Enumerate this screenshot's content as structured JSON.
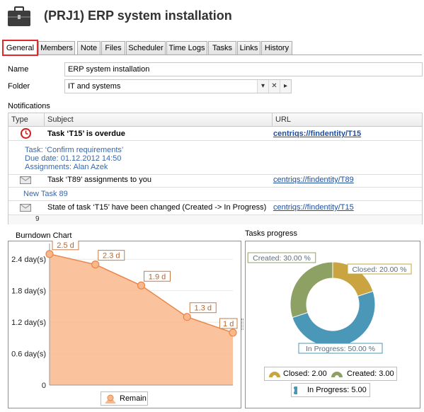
{
  "window": {
    "title": "(PRJ1) ERP system installation",
    "icon": "briefcase-icon"
  },
  "tabs": [
    {
      "label": "General",
      "active": true
    },
    {
      "label": "Members"
    },
    {
      "label": "Note"
    },
    {
      "label": "Files"
    },
    {
      "label": "Scheduler"
    },
    {
      "label": "Time Logs"
    },
    {
      "label": "Tasks"
    },
    {
      "label": "Links"
    },
    {
      "label": "History"
    }
  ],
  "form": {
    "name_label": "Name",
    "name_value": "ERP system installation",
    "folder_label": "Folder",
    "folder_value": "IT and systems"
  },
  "notifications": {
    "title": "Notifications",
    "columns": [
      "Type",
      "Subject",
      "URL"
    ],
    "rows": [
      {
        "icon": "overdue-clock-icon",
        "subject": "Task ‘T15’ is overdue",
        "url": "centriqs://findentity/T15",
        "details": [
          "Task: ‘Confirm requirements’",
          "Due date: 01.12.2012 14:50",
          "Assignments: Alan Azek"
        ]
      },
      {
        "icon": "envelope-icon",
        "subject": "Task ‘T89’ assignments to you",
        "url": "centriqs://findentity/T89",
        "details": [
          "New Task 89"
        ]
      },
      {
        "icon": "envelope-icon",
        "subject": "State of task ‘T15’ have been changed (Created -> In Progress)",
        "url": "centriqs://findentity/T15",
        "details": []
      }
    ],
    "footer_count": "9"
  },
  "burndown": {
    "title": "Burndown Chart",
    "legend": "Remain",
    "fill_color": "#f9b88c",
    "line_color": "#e8864a"
  },
  "progress": {
    "title": "Tasks progress",
    "legend": [
      {
        "label": "Closed: 2.00",
        "color": "#c9a441"
      },
      {
        "label": "Created: 3.00",
        "color": "#8ea165"
      },
      {
        "label": "In Progress: 5.00",
        "color": "#4a97b8"
      }
    ]
  },
  "chart_data": [
    {
      "type": "area",
      "title": "Burndown Chart",
      "series": [
        {
          "name": "Remain",
          "x": [
            1,
            2,
            3,
            4,
            5
          ],
          "values": [
            2.5,
            2.3,
            1.9,
            1.3,
            1.0
          ],
          "labels": [
            "2.5 d",
            "2.3 d",
            "1.9 d",
            "1.3 d",
            "1 d"
          ]
        }
      ],
      "yticks": [
        "0",
        "0.6 day(s)",
        "1.2 day(s)",
        "1.8 day(s)",
        "2.4 day(s)"
      ],
      "ylim": [
        0,
        2.7
      ],
      "grid": true,
      "legend_position": "bottom"
    },
    {
      "type": "pie",
      "title": "Tasks progress",
      "donut": true,
      "slices": [
        {
          "name": "Closed",
          "value": 2.0,
          "label": "Closed: 20.00 %",
          "color": "#c9a441"
        },
        {
          "name": "In Progress",
          "value": 5.0,
          "label": "In Progress: 50.00 %",
          "color": "#4a97b8"
        },
        {
          "name": "Created",
          "value": 3.0,
          "label": "Created: 30.00 %",
          "color": "#8ea165"
        }
      ],
      "legend_position": "bottom"
    }
  ]
}
